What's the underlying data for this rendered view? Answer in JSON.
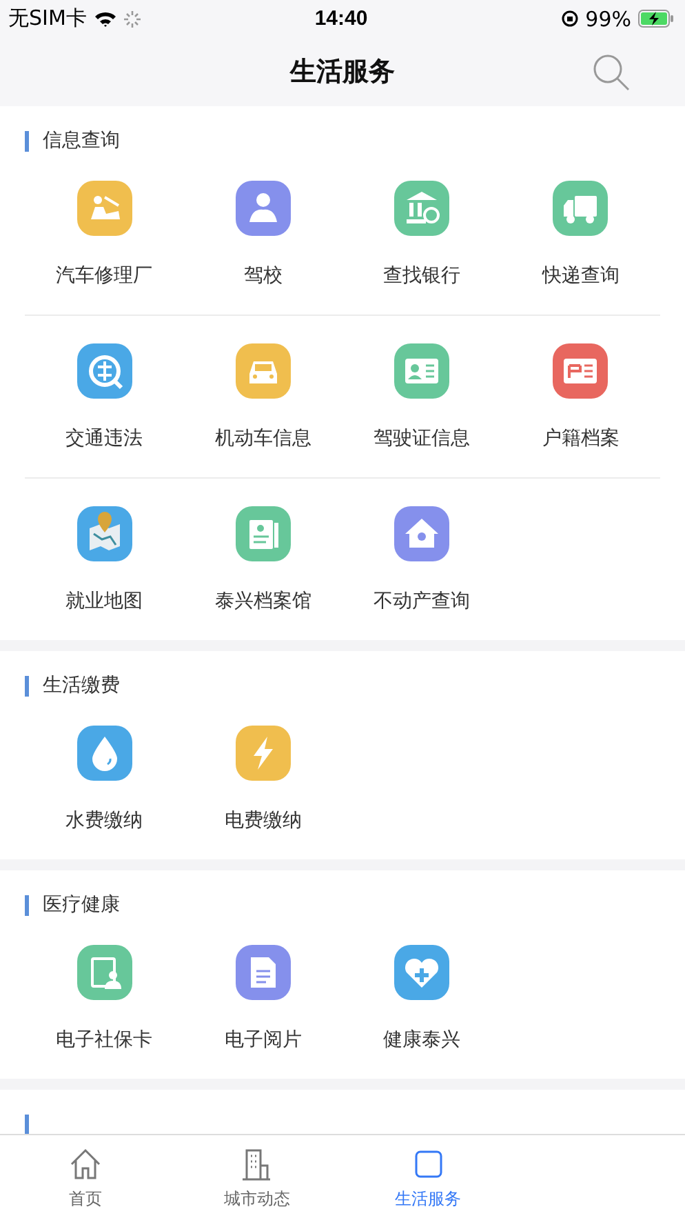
{
  "status_bar": {
    "carrier": "无SIM卡",
    "time": "14:40",
    "battery": "99%"
  },
  "nav": {
    "title": "生活服务"
  },
  "sections": [
    {
      "title": "信息查询",
      "items": [
        {
          "label": "汽车修理厂",
          "color": "#f0be4e"
        },
        {
          "label": "驾校",
          "color": "#8590ec"
        },
        {
          "label": "查找银行",
          "color": "#67c79a"
        },
        {
          "label": "快递查询",
          "color": "#67c79a"
        },
        {
          "label": "交通违法",
          "color": "#4aa8e6"
        },
        {
          "label": "机动车信息",
          "color": "#f0be4e"
        },
        {
          "label": "驾驶证信息",
          "color": "#67c79a"
        },
        {
          "label": "户籍档案",
          "color": "#e8675f"
        },
        {
          "label": "就业地图",
          "color": "#4aa8e6"
        },
        {
          "label": "泰兴档案馆",
          "color": "#67c79a"
        },
        {
          "label": "不动产查询",
          "color": "#8590ec"
        }
      ]
    },
    {
      "title": "生活缴费",
      "items": [
        {
          "label": "水费缴纳",
          "color": "#4aa8e6"
        },
        {
          "label": "电费缴纳",
          "color": "#f0be4e"
        }
      ]
    },
    {
      "title": "医疗健康",
      "items": [
        {
          "label": "电子社保卡",
          "color": "#67c79a"
        },
        {
          "label": "电子阅片",
          "color": "#8590ec"
        },
        {
          "label": "健康泰兴",
          "color": "#4aa8e6"
        }
      ]
    }
  ],
  "tab_bar": [
    {
      "label": "首页",
      "selected": false
    },
    {
      "label": "城市动态",
      "selected": false
    },
    {
      "label": "生活服务",
      "selected": true
    }
  ]
}
